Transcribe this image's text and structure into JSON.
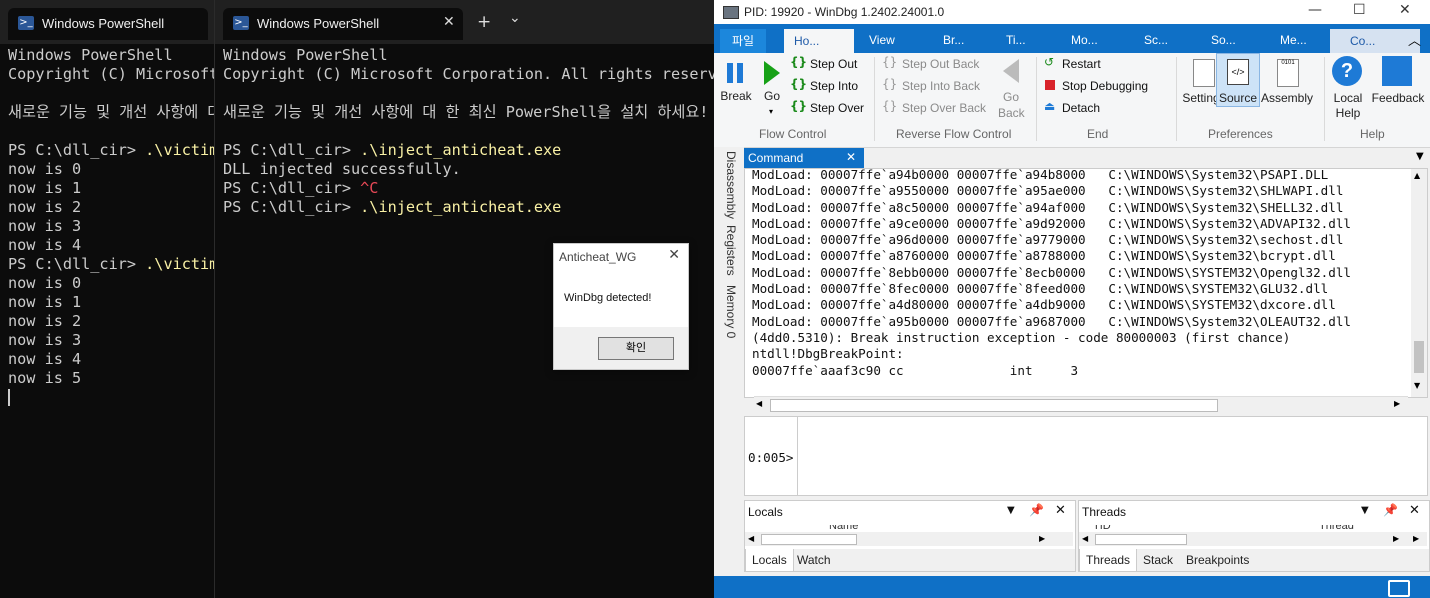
{
  "terminal1": {
    "tab_title": "Windows PowerShell",
    "lines": [
      {
        "t": "Windows PowerShell",
        "c": ""
      },
      {
        "t": "Copyright (C) Microsoft Corporation. All rights reserved.",
        "c": ""
      },
      {
        "t": "",
        "c": ""
      },
      {
        "t": "새로운 기능 및 개선 사항에 대 한 최신 PowerShell을 설치 하세요!",
        "c": ""
      },
      {
        "t": "",
        "c": ""
      },
      {
        "t": "PS C:\\dll_cir> ",
        "c": "",
        "cmd": ".\\victim.exe"
      },
      {
        "t": "now is 0",
        "c": ""
      },
      {
        "t": "now is 1",
        "c": ""
      },
      {
        "t": "now is 2",
        "c": ""
      },
      {
        "t": "now is 3",
        "c": ""
      },
      {
        "t": "now is 4",
        "c": ""
      },
      {
        "t": "PS C:\\dll_cir> ",
        "c": "",
        "cmd": ".\\victim.exe"
      },
      {
        "t": "now is 0",
        "c": ""
      },
      {
        "t": "now is 1",
        "c": ""
      },
      {
        "t": "now is 2",
        "c": ""
      },
      {
        "t": "now is 3",
        "c": ""
      },
      {
        "t": "now is 4",
        "c": ""
      },
      {
        "t": "now is 5",
        "c": ""
      }
    ]
  },
  "terminal2": {
    "tab_title": "Windows PowerShell",
    "new_tab": "+",
    "dropdown": "⌄",
    "lines": [
      {
        "t": "Windows PowerShell",
        "c": ""
      },
      {
        "t": "Copyright (C) Microsoft Corporation. All rights reserved.",
        "c": ""
      },
      {
        "t": "",
        "c": ""
      },
      {
        "t": "새로운 기능 및 개선 사항에 대 한 최신 PowerShell을 설치 하세요!",
        "c": ""
      },
      {
        "t": "",
        "c": ""
      },
      {
        "t": "PS C:\\dll_cir> ",
        "c": "",
        "cmd": ".\\inject_anticheat.exe"
      },
      {
        "t": "DLL injected successfully.",
        "c": ""
      },
      {
        "t": "PS C:\\dll_cir> ",
        "c": "",
        "red": "^C"
      },
      {
        "t": "PS C:\\dll_cir> ",
        "c": "",
        "cmd": ".\\inject_anticheat.exe"
      }
    ]
  },
  "dialog": {
    "title": "Anticheat_WG",
    "message": "WinDbg detected!",
    "ok_label": "확인"
  },
  "windbg": {
    "title": "PID: 19920 - WinDbg 1.2402.24001.0",
    "ribbon_tabs": [
      "파일",
      "Ho...",
      "View",
      "Br...",
      "Ti...",
      "Mo...",
      "Sc...",
      "So...",
      "Me...",
      "Co..."
    ],
    "flow": {
      "break": "Break",
      "go": "Go",
      "step_out": "Step Out",
      "step_into": "Step Into",
      "step_over": "Step Over",
      "group": "Flow Control"
    },
    "reverse": {
      "step_out_back": "Step Out Back",
      "step_into_back": "Step Into Back",
      "step_over_back": "Step Over Back",
      "go_back": "Go Back",
      "group": "Reverse Flow Control"
    },
    "end": {
      "restart": "Restart",
      "stop": "Stop Debugging",
      "detach": "Detach",
      "group": "End"
    },
    "prefs": {
      "settings": "Settings",
      "source": "Source",
      "assembly": "Assembly",
      "group": "Preferences"
    },
    "help": {
      "local_help": "Local Help",
      "feedback": "Feedback",
      "group": "Help"
    },
    "side_tabs": [
      "Disassembly",
      "Registers",
      "Memory 0"
    ],
    "command_tab": "Command",
    "output": [
      "ModLoad: 00007ffe`a94b0000 00007ffe`a94b8000   C:\\WINDOWS\\System32\\PSAPI.DLL",
      "ModLoad: 00007ffe`a9550000 00007ffe`a95ae000   C:\\WINDOWS\\System32\\SHLWAPI.dll",
      "ModLoad: 00007ffe`a8c50000 00007ffe`a94af000   C:\\WINDOWS\\System32\\SHELL32.dll",
      "ModLoad: 00007ffe`a9ce0000 00007ffe`a9d92000   C:\\WINDOWS\\System32\\ADVAPI32.dll",
      "ModLoad: 00007ffe`a96d0000 00007ffe`a9779000   C:\\WINDOWS\\System32\\sechost.dll",
      "ModLoad: 00007ffe`a8760000 00007ffe`a8788000   C:\\WINDOWS\\System32\\bcrypt.dll",
      "ModLoad: 00007ffe`8ebb0000 00007ffe`8ecb0000   C:\\WINDOWS\\SYSTEM32\\Opengl32.dll",
      "ModLoad: 00007ffe`8fec0000 00007ffe`8feed000   C:\\WINDOWS\\SYSTEM32\\GLU32.dll",
      "ModLoad: 00007ffe`a4d80000 00007ffe`a4db9000   C:\\WINDOWS\\SYSTEM32\\dxcore.dll",
      "ModLoad: 00007ffe`a95b0000 00007ffe`a9687000   C:\\WINDOWS\\System32\\OLEAUT32.dll",
      "(4dd0.5310): Break instruction exception - code 80000003 (first chance)",
      "ntdll!DbgBreakPoint:",
      "00007ffe`aaaf3c90 cc              int     3"
    ],
    "prompt": "0:005>",
    "locals_panel": {
      "title": "Locals",
      "col": "Name",
      "tabs": [
        "Locals",
        "Watch"
      ]
    },
    "threads_panel": {
      "title": "Threads",
      "col1": "TID",
      "col2": "Thread",
      "tabs": [
        "Threads",
        "Stack",
        "Breakpoints"
      ]
    }
  }
}
